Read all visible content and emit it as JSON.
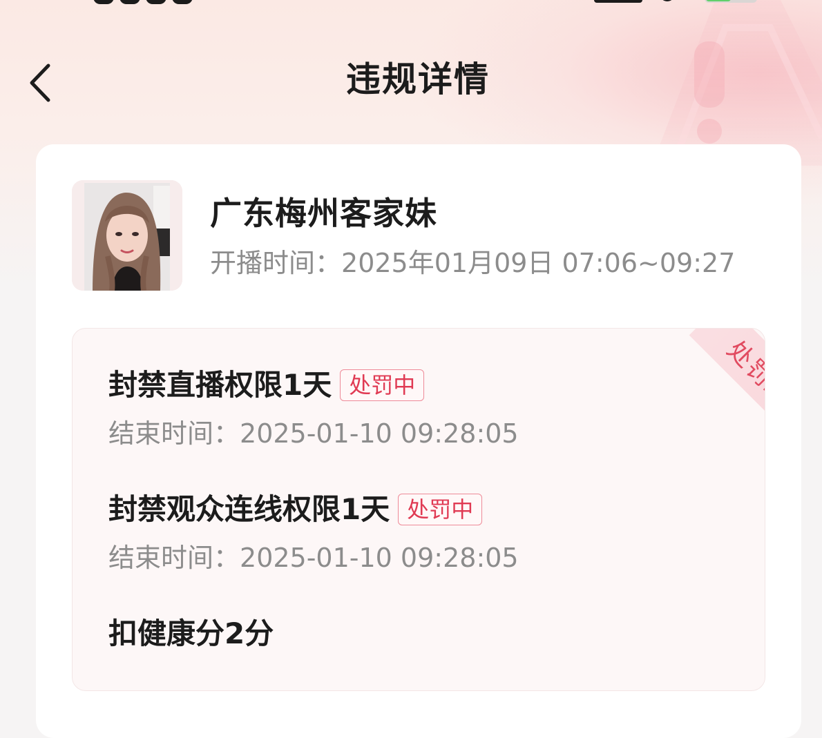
{
  "header": {
    "title": "违规详情"
  },
  "streamer": {
    "name": "广东梅州客家妹",
    "broadcast_time_label": "开播时间：",
    "broadcast_time_value": "2025年01月09日 07:06~09:27"
  },
  "result": {
    "ribbon_label": "处罚结果",
    "penalties": [
      {
        "title": "封禁直播权限1天",
        "status": "处罚中",
        "end_time_label": "结束时间：",
        "end_time_value": "2025-01-10 09:28:05"
      },
      {
        "title": "封禁观众连线权限1天",
        "status": "处罚中",
        "end_time_label": "结束时间：",
        "end_time_value": "2025-01-10 09:28:05"
      },
      {
        "title": "扣健康分2分"
      }
    ]
  },
  "icons": {
    "back": "chevron-left-icon",
    "warning": "warning-triangle-icon"
  },
  "colors": {
    "accent_red": "#e03a53",
    "text_primary": "#1c1c1c",
    "text_secondary": "#8c8c8c",
    "page_bg": "#f6f4f4",
    "header_tint": "#fbe9e4"
  }
}
